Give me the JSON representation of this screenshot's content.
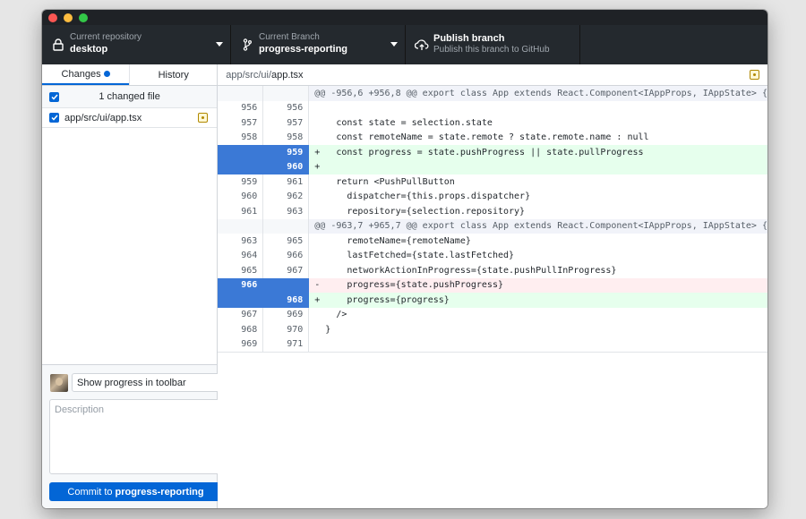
{
  "toolbar": {
    "repo_label": "Current repository",
    "repo_value": "desktop",
    "branch_label": "Current Branch",
    "branch_value": "progress-reporting",
    "publish_label": "Publish branch",
    "publish_sub": "Publish this branch to GitHub"
  },
  "sidebar": {
    "tabs": [
      {
        "label": "Changes"
      },
      {
        "label": "History"
      }
    ],
    "changed_count": "1 changed file",
    "files": [
      {
        "path": "app/src/ui/app.tsx"
      }
    ],
    "commit": {
      "summary": "Show progress in toolbar",
      "description_placeholder": "Description",
      "button_prefix": "Commit to",
      "button_branch": "progress-reporting"
    }
  },
  "diff": {
    "path_dir": "app/src/ui/",
    "path_file": "app.tsx",
    "lines": [
      {
        "type": "hunk",
        "old": "",
        "new": "",
        "text": "@@ -956,6 +956,8 @@ export class App extends React.Component<IAppProps, IAppState> {"
      },
      {
        "type": "ctx",
        "old": "956",
        "new": "956",
        "text": " "
      },
      {
        "type": "ctx",
        "old": "957",
        "new": "957",
        "text": "    const state = selection.state"
      },
      {
        "type": "ctx",
        "old": "958",
        "new": "958",
        "text": "    const remoteName = state.remote ? state.remote.name : null"
      },
      {
        "type": "add",
        "old": "",
        "new": "959",
        "text": "+   const progress = state.pushProgress || state.pullProgress"
      },
      {
        "type": "add",
        "old": "",
        "new": "960",
        "text": "+"
      },
      {
        "type": "ctx",
        "old": "959",
        "new": "961",
        "text": "    return <PushPullButton"
      },
      {
        "type": "ctx",
        "old": "960",
        "new": "962",
        "text": "      dispatcher={this.props.dispatcher}"
      },
      {
        "type": "ctx",
        "old": "961",
        "new": "963",
        "text": "      repository={selection.repository}"
      },
      {
        "type": "hunk",
        "old": "",
        "new": "",
        "text": "@@ -963,7 +965,7 @@ export class App extends React.Component<IAppProps, IAppState> {"
      },
      {
        "type": "ctx",
        "old": "963",
        "new": "965",
        "text": "      remoteName={remoteName}"
      },
      {
        "type": "ctx",
        "old": "964",
        "new": "966",
        "text": "      lastFetched={state.lastFetched}"
      },
      {
        "type": "ctx",
        "old": "965",
        "new": "967",
        "text": "      networkActionInProgress={state.pushPullInProgress}"
      },
      {
        "type": "del",
        "old": "966",
        "new": "",
        "text": "-     progress={state.pushProgress}"
      },
      {
        "type": "add",
        "old": "",
        "new": "968",
        "text": "+     progress={progress}"
      },
      {
        "type": "ctx",
        "old": "967",
        "new": "969",
        "text": "    />"
      },
      {
        "type": "ctx",
        "old": "968",
        "new": "970",
        "text": "  }"
      },
      {
        "type": "ctx",
        "old": "969",
        "new": "971",
        "text": " "
      }
    ]
  },
  "colors": {
    "accent": "#0366d6",
    "selected_gutter": "#3b79d6",
    "added_bg": "#e6ffed",
    "removed_bg": "#ffeef0",
    "toolbar_bg": "#24292e"
  }
}
